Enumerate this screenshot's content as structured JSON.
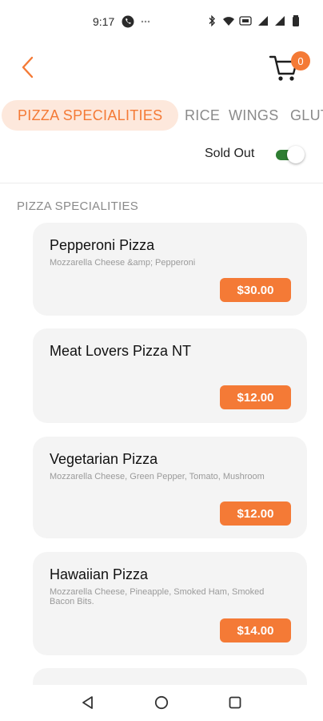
{
  "status_bar": {
    "time": "9:17"
  },
  "header": {
    "back_icon": "chevron-left-icon",
    "cart_icon": "cart-icon",
    "cart_count": "0"
  },
  "tabs": [
    {
      "label": "PIZZA SPECIALITIES",
      "active": true
    },
    {
      "label": "RICE",
      "active": false
    },
    {
      "label": "WINGS",
      "active": false
    },
    {
      "label": "GLUTEN FREE",
      "active": false
    }
  ],
  "filter": {
    "sold_out_label": "Sold Out",
    "sold_out_enabled": true
  },
  "section": {
    "title": "PIZZA SPECIALITIES"
  },
  "items": [
    {
      "name": "Pepperoni Pizza",
      "description": "Mozzarella Cheese &amp; Pepperoni",
      "price": "$30.00"
    },
    {
      "name": "Meat Lovers Pizza NT",
      "description": "",
      "price": "$12.00"
    },
    {
      "name": "Vegetarian Pizza",
      "description": "Mozzarella Cheese, Green Pepper, Tomato, Mushroom",
      "price": "$12.00"
    },
    {
      "name": "Hawaiian Pizza",
      "description": "Mozzarella Cheese, Pineapple, Smoked Ham, Smoked Bacon Bits.",
      "price": "$14.00"
    }
  ],
  "colors": {
    "accent": "#f47a36",
    "accent_light": "#fde8dc",
    "toggle_on": "#2e7d32",
    "card_bg": "#f4f4f4"
  }
}
